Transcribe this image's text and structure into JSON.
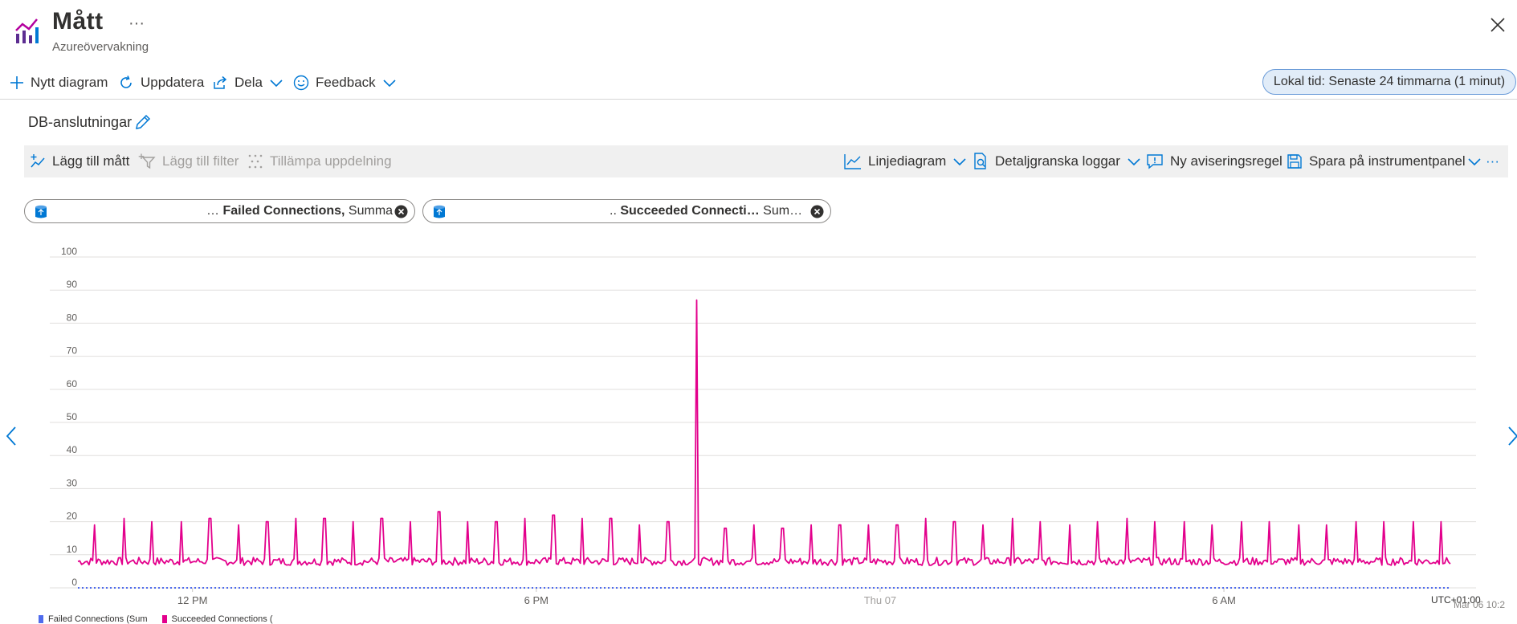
{
  "header": {
    "title": "Mått",
    "subtitle": "Azureövervakning",
    "more": "···",
    "logo_icon": "metrics-chart-icon",
    "close_icon": "close-icon"
  },
  "commands": {
    "new_chart": "Nytt diagram",
    "refresh": "Uppdatera",
    "share": "Dela",
    "feedback": "Feedback",
    "time_range": "Lokal tid: Senaste 24 timmarna (1 minut)"
  },
  "chart_title": "DB-anslutningar",
  "toolbar": {
    "add_metric": "Lägg till mått",
    "add_filter": "Lägg till filter",
    "apply_splitting": "Tillämpa uppdelning",
    "chart_type": "Linjediagram",
    "drill_logs": "Detaljgranska loggar",
    "new_alert": "Ny aviseringsregel",
    "save_dashboard": "Spara på instrumentpanel",
    "more": "···"
  },
  "metric_pills": [
    {
      "prefix": "…",
      "metric": "Failed Connections,",
      "aggregation": "Summa"
    },
    {
      "prefix": "..",
      "metric": "Succeeded Connecti…",
      "aggregation": "Sum…"
    }
  ],
  "colors": {
    "accent": "#0078d4",
    "failed_series": "#4f6bed",
    "succeeded_series": "#e3008c",
    "time_pill_bg": "#e1ecf8"
  },
  "chart_data": {
    "type": "line",
    "title": "",
    "xlabel": "",
    "ylabel": "",
    "ylim": [
      0,
      100
    ],
    "y_ticks": [
      "0",
      "10",
      "20",
      "30",
      "40",
      "50",
      "60",
      "70",
      "80",
      "90",
      "100"
    ],
    "x_ticks": [
      {
        "label": "12 PM",
        "muted": false
      },
      {
        "label": "6 PM",
        "muted": false
      },
      {
        "label": "Thu 07",
        "muted": true
      },
      {
        "label": "6 AM",
        "muted": false
      }
    ],
    "x_tick_hours": [
      2,
      8,
      14,
      20
    ],
    "x_range_hours": [
      0,
      24.4
    ],
    "timezone": "UTC+01:00",
    "end_time": "Mar 06 10:2",
    "grid": true,
    "legend_position": "bottom-left",
    "series": [
      {
        "name": "Failed Connections (Sum",
        "color": "#4f6bed",
        "style": "dotted",
        "baseline": 0,
        "spikes": []
      },
      {
        "name": "Succeeded Connections (",
        "color": "#e3008c",
        "style": "solid",
        "baseline": 8,
        "spike_interval_hours": 0.5,
        "spikes": [
          19,
          21,
          20,
          20,
          21,
          19,
          20,
          21,
          21,
          20,
          21,
          20,
          23,
          20,
          20,
          21,
          22,
          21,
          21,
          19,
          20,
          87,
          18,
          19,
          18,
          19,
          19,
          19,
          19,
          21,
          20,
          19,
          21,
          20,
          19,
          20,
          21,
          20,
          20,
          19,
          20,
          20,
          19,
          19,
          20,
          20,
          20,
          20,
          18
        ]
      }
    ]
  }
}
